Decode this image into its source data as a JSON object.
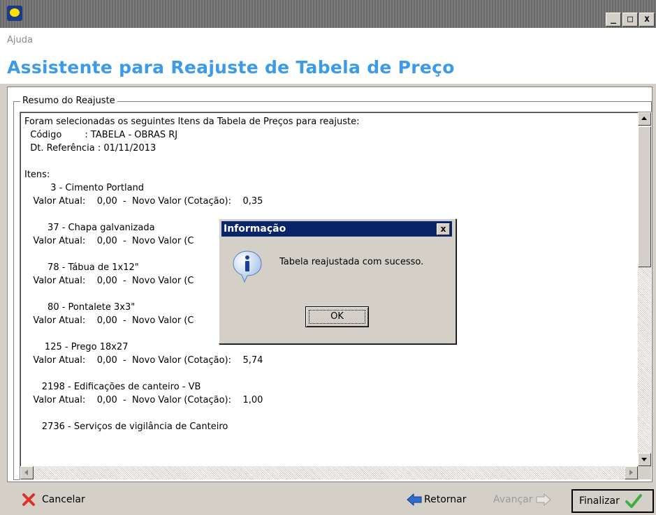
{
  "window": {
    "title": "",
    "controls": {
      "minimize": "_",
      "maximize": "□",
      "close": "x"
    }
  },
  "menu": {
    "ajuda": "Ajuda"
  },
  "header": {
    "title": "Assistente para Reajuste de Tabela de Preço"
  },
  "summary": {
    "group_label": "Resumo do Reajuste",
    "lines": [
      "Foram selecionadas os seguintes Itens da Tabela de Preços para reajuste:",
      "  Código        : TABELA - OBRAS RJ",
      "  Dt. Referência : 01/11/2013",
      "",
      "Itens:",
      "         3 - Cimento Portland",
      "   Valor Atual:    0,00  -  Novo Valor (Cotação):    0,35",
      "",
      "        37 - Chapa galvanizada",
      "   Valor Atual:    0,00  -  Novo Valor (C",
      "",
      "        78 - Tábua de 1x12\"",
      "   Valor Atual:    0,00  -  Novo Valor (C",
      "",
      "        80 - Pontalete 3x3\"",
      "   Valor Atual:    0,00  -  Novo Valor (C",
      "",
      "       125 - Prego 18x27",
      "   Valor Atual:    0,00  -  Novo Valor (Cotação):    5,74",
      "",
      "      2198 - Edificações de canteiro - VB",
      "   Valor Atual:    0,00  -  Novo Valor (Cotação):    1,00",
      "",
      "      2736 - Serviços de vigilância de Canteiro"
    ]
  },
  "dialog": {
    "title": "Informação",
    "message": "Tabela reajustada com sucesso.",
    "ok_label": "OK",
    "close": "x"
  },
  "footer": {
    "cancel_label": "Cancelar",
    "back_label": "Retornar",
    "next_label": "Avançar",
    "finish_label": "Finalizar"
  },
  "colors": {
    "title_blue": "#3b9bea",
    "dialog_title_bg": "#0a246a",
    "cancel_red": "#e0302a",
    "finish_green": "#3cb043",
    "nav_blue": "#2a6fd1"
  },
  "icons": {
    "app": "app-icon",
    "cancel": "red-x-icon",
    "back": "blue-left-arrow-icon",
    "next": "gray-right-arrow-icon",
    "finish": "green-check-icon",
    "dialog": "info-icon"
  }
}
